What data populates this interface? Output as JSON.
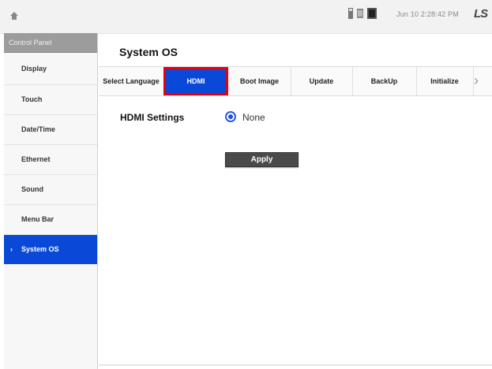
{
  "status": {
    "datetime": "Jun 10 2:28:42 PM",
    "brand": "LS",
    "icons": [
      "usb-icon",
      "sd-card-icon",
      "display-icon"
    ]
  },
  "sidebar": {
    "header": "Control Panel",
    "items": [
      {
        "label": "Display"
      },
      {
        "label": "Touch"
      },
      {
        "label": "Date/Time"
      },
      {
        "label": "Ethernet"
      },
      {
        "label": "Sound"
      },
      {
        "label": "Menu Bar"
      },
      {
        "label": "System OS",
        "active": true
      }
    ]
  },
  "panel": {
    "title": "System OS",
    "tabs": [
      {
        "label": "Select Language"
      },
      {
        "label": "HDMI",
        "selected": true
      },
      {
        "label": "Boot Image"
      },
      {
        "label": "Update"
      },
      {
        "label": "BackUp"
      },
      {
        "label": "Initialize"
      }
    ],
    "hdmi": {
      "label": "HDMI Settings",
      "option": "None",
      "apply": "Apply"
    }
  },
  "colors": {
    "accent": "#0a49d8",
    "highlight_border": "#e3000f"
  }
}
